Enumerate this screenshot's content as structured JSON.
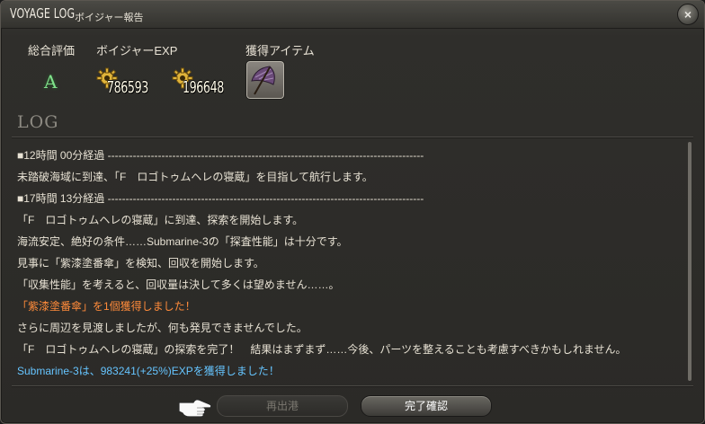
{
  "window": {
    "title": "VOYAGE LOG",
    "subtitle": "ボイジャー報告",
    "close_label": "×"
  },
  "summary": {
    "grade_label": "総合評価",
    "grade_value": "A",
    "exp_label": "ボイジャーEXP",
    "exp_values": [
      "786593",
      "196648"
    ],
    "item_label": "獲得アイテム",
    "item_icon": "parasol-item-icon"
  },
  "log": {
    "heading": "LOG",
    "lines": [
      {
        "text": "■12時間 00分経過 ----------------------------------------------------------------------------------------",
        "style": "normal"
      },
      {
        "text": "未踏破海域に到達、「F　ロゴトゥムヘレの寝蔵」を目指して航行します。",
        "style": "normal"
      },
      {
        "text": "■17時間 13分経過 ----------------------------------------------------------------------------------------",
        "style": "normal"
      },
      {
        "text": "「F　ロゴトゥムヘレの寝蔵」に到達、探索を開始します。",
        "style": "normal"
      },
      {
        "text": "海流安定、絶好の条件……Submarine-3の「探査性能」は十分です。",
        "style": "normal"
      },
      {
        "text": "見事に「紫漆塗番傘」を検知、回収を開始します。",
        "style": "normal"
      },
      {
        "text": "「収集性能」を考えると、回収量は決して多くは望めません……。",
        "style": "normal"
      },
      {
        "text": "「紫漆塗番傘」を1個獲得しました！",
        "style": "orange"
      },
      {
        "text": "さらに周辺を見渡しましたが、何も発見できませんでした。",
        "style": "normal"
      },
      {
        "text": "「F　ロゴトゥムヘレの寝蔵」の探索を完了！　結果はまずまず……今後、パーツを整えることも考慮すべきかもしれません。",
        "style": "normal"
      },
      {
        "text": "Submarine-3は、983241(+25%)EXPを獲得しました！",
        "style": "blue"
      }
    ]
  },
  "footer": {
    "depart_label": "再出港",
    "confirm_label": "完了確認"
  },
  "colors": {
    "orange_text": "#ff8b3a",
    "blue_text": "#66c4ff",
    "grade_green": "#7fe08a"
  }
}
